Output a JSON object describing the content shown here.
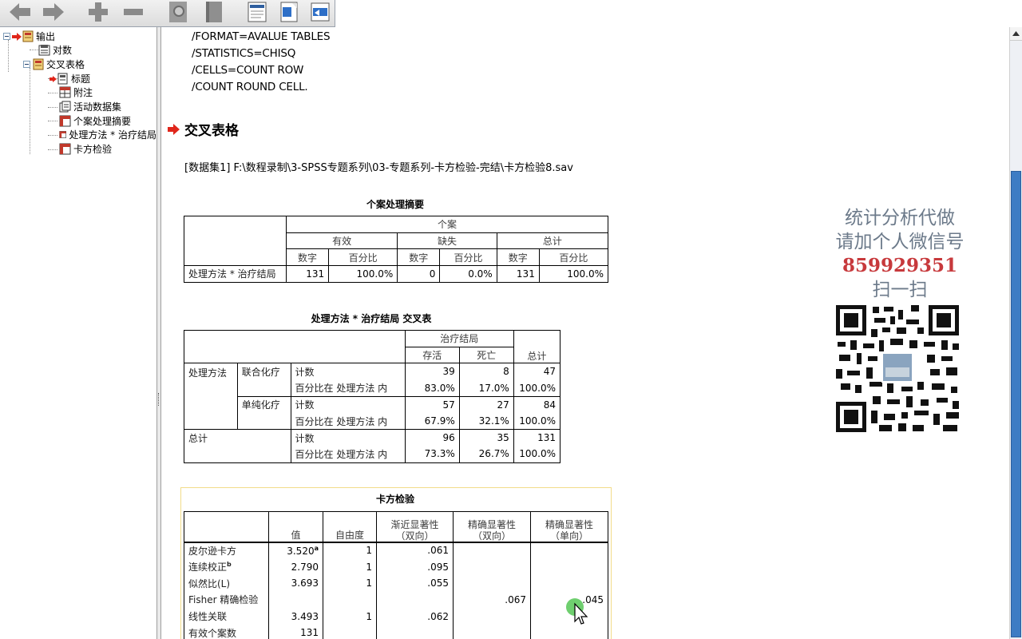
{
  "tree": {
    "items": [
      {
        "label": "输出",
        "level": 0
      },
      {
        "label": "对数",
        "level": 1
      },
      {
        "label": "交叉表格",
        "level": 1
      },
      {
        "label": "标题",
        "level": 2
      },
      {
        "label": "附注",
        "level": 2
      },
      {
        "label": "活动数据集",
        "level": 2
      },
      {
        "label": "个案处理摘要",
        "level": 2
      },
      {
        "label": "处理方法 * 治疗结局",
        "level": 2
      },
      {
        "label": "卡方检验",
        "level": 2
      }
    ]
  },
  "syntax": {
    "lines": [
      "/FORMAT=AVALUE TABLES",
      "/STATISTICS=CHISQ",
      "/CELLS=COUNT ROW",
      "/COUNT ROUND CELL."
    ]
  },
  "section": {
    "title": "交叉表格",
    "dataset": "[数据集1] F:\\数程录制\\3-SPSS专题系列\\03-专题系列-卡方检验-完结\\卡方检验8.sav"
  },
  "case_summary": {
    "title": "个案处理摘要",
    "group_header": "个案",
    "valid": "有效",
    "missing": "缺失",
    "total": "总计",
    "count": "数字",
    "percent": "百分比",
    "row_label": "处理方法 * 治疗结局",
    "values": [
      "131",
      "100.0%",
      "0",
      "0.0%",
      "131",
      "100.0%"
    ]
  },
  "crosstab": {
    "title": "处理方法 * 治疗结局 交叉表",
    "col_group": "治疗结局",
    "col1": "存活",
    "col2": "死亡",
    "col_total": "总计",
    "row_var": "处理方法",
    "rows": [
      {
        "group": "联合化疗",
        "stat": "计数",
        "v1": "39",
        "v2": "8",
        "vt": "47"
      },
      {
        "group": "",
        "stat": "百分比在 处理方法 内",
        "v1": "83.0%",
        "v2": "17.0%",
        "vt": "100.0%"
      },
      {
        "group": "单纯化疗",
        "stat": "计数",
        "v1": "57",
        "v2": "27",
        "vt": "84"
      },
      {
        "group": "",
        "stat": "百分比在 处理方法 内",
        "v1": "67.9%",
        "v2": "32.1%",
        "vt": "100.0%"
      }
    ],
    "total_label": "总计",
    "total_rows": [
      {
        "stat": "计数",
        "v1": "96",
        "v2": "35",
        "vt": "131"
      },
      {
        "stat": "百分比在 处理方法 内",
        "v1": "73.3%",
        "v2": "26.7%",
        "vt": "100.0%"
      }
    ]
  },
  "chi_square": {
    "title": "卡方检验",
    "headers": {
      "value": "值",
      "df": "自由度",
      "asymp": "渐近显著性",
      "asymp_sub": "（双向）",
      "exact2": "精确显著性",
      "exact2_sub": "（双向）",
      "exact1": "精确显著性",
      "exact1_sub": "（单向）"
    },
    "rows": [
      {
        "label": "皮尔逊卡方",
        "sup": "",
        "value": "3.520",
        "value_sup": "a",
        "df": "1",
        "asymp": ".061",
        "exact2": "",
        "exact1": ""
      },
      {
        "label": "连续校正",
        "sup": "b",
        "value": "2.790",
        "value_sup": "",
        "df": "1",
        "asymp": ".095",
        "exact2": "",
        "exact1": ""
      },
      {
        "label": "似然比(L)",
        "sup": "",
        "value": "3.693",
        "value_sup": "",
        "df": "1",
        "asymp": ".055",
        "exact2": "",
        "exact1": ""
      },
      {
        "label": "Fisher 精确检验",
        "sup": "",
        "value": "",
        "value_sup": "",
        "df": "",
        "asymp": "",
        "exact2": ".067",
        "exact1": ".045"
      },
      {
        "label": "线性关联",
        "sup": "",
        "value": "3.493",
        "value_sup": "",
        "df": "1",
        "asymp": ".062",
        "exact2": "",
        "exact1": ""
      },
      {
        "label": "有效个案数",
        "sup": "",
        "value": "131",
        "value_sup": "",
        "df": "",
        "asymp": "",
        "exact2": "",
        "exact1": ""
      }
    ]
  },
  "watermark": {
    "line1": "统计分析代做",
    "line2_prefix": "请加个人微信号",
    "line2_number": "859929351",
    "line3": "扫一扫"
  },
  "colors": {
    "accent_red": "#e0261b",
    "scroll_thumb": "#3e7cc4",
    "watermark_text": "#6c7a8a",
    "wechat_number": "#c7393c"
  }
}
